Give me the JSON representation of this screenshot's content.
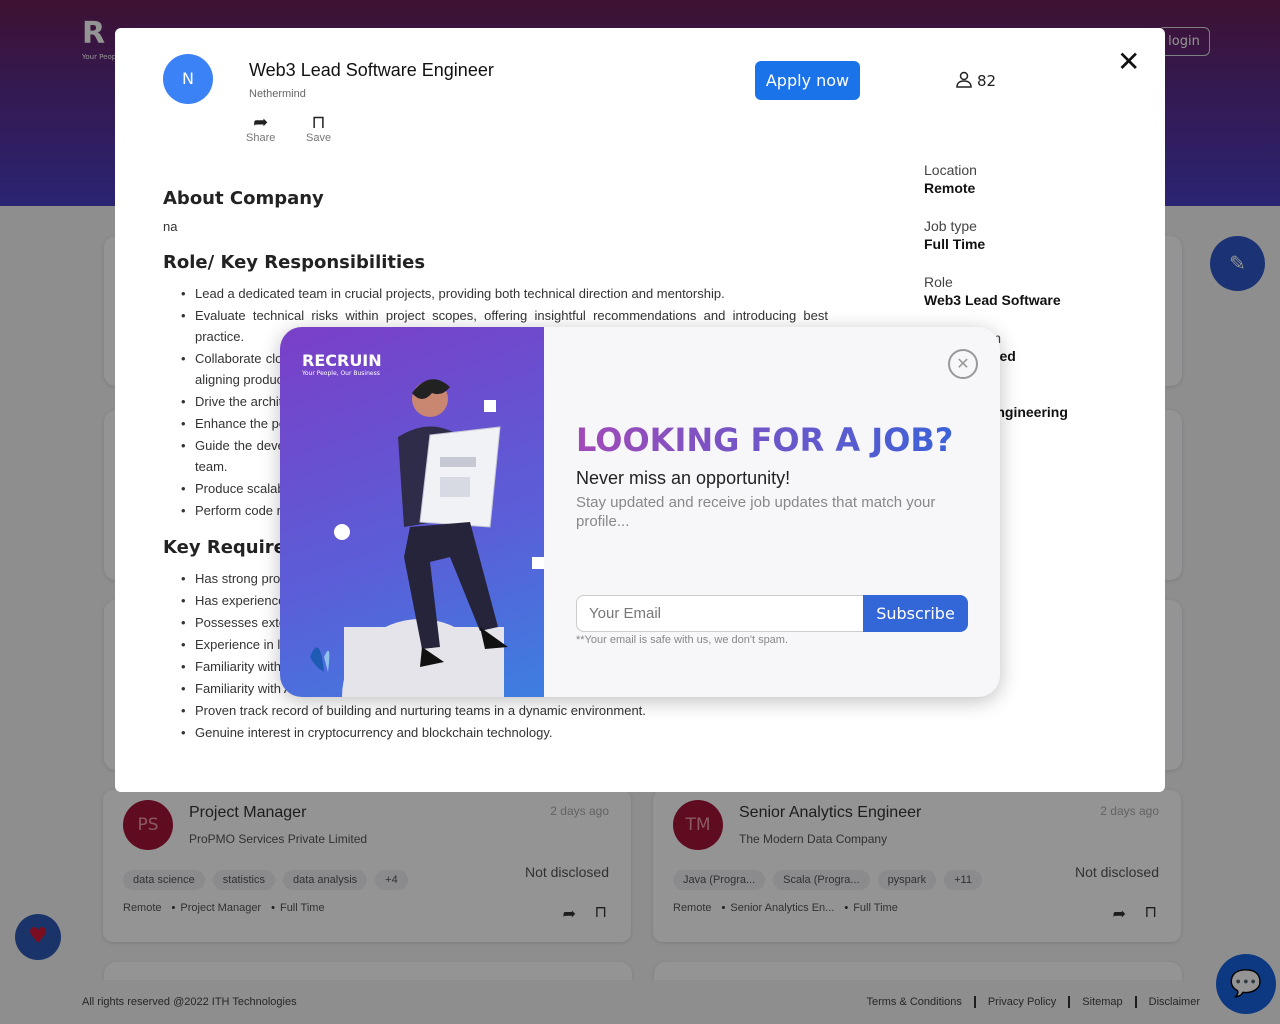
{
  "app": {
    "logo_text": "R",
    "logo_tagline": "Your People, Our Business",
    "login_label": "login",
    "customize_icon": "magic-wand-icon"
  },
  "background_jobs": [
    {
      "avatar": "PS",
      "title": "Project Manager",
      "company": "ProPMO Services Private Limited",
      "posted": "2 days ago",
      "salary": "Not disclosed",
      "tags": [
        "data science",
        "statistics",
        "data analysis",
        "+4"
      ],
      "meta": [
        "Remote",
        "Project Manager",
        "Full Time"
      ]
    },
    {
      "avatar": "TM",
      "title": "Senior Analytics Engineer",
      "company": "The Modern Data Company",
      "posted": "2 days ago",
      "salary": "Not disclosed",
      "tags": [
        "Java (Progra...",
        "Scala (Progra...",
        "pyspark",
        "+11"
      ],
      "meta": [
        "Remote",
        "Senior Analytics En...",
        "Full Time"
      ]
    }
  ],
  "footer": {
    "copyright": "All rights reserved @2022 ITH Technologies",
    "links": [
      "Terms & Conditions",
      "Privacy Policy",
      "Sitemap",
      "Disclaimer"
    ]
  },
  "job_modal": {
    "avatar_letter": "N",
    "title": "Web3 Lead Software Engineer",
    "company": "Nethermind",
    "share_label": "Share",
    "save_label": "Save",
    "apply_label": "Apply now",
    "applicants": "82",
    "about_heading": "About Company",
    "about_text": "na",
    "role_heading": "Role/ Key Responsibilities",
    "responsibilities": [
      "Lead a dedicated team in crucial projects, providing both technical direction and mentorship.",
      "Evaluate technical risks within project scopes, offering insightful recommendations and introducing best practice.",
      "Collaborate closely with stakeholders to understand requirements and translate them into technical solutions, aligning product and customer needs.",
      "Drive the architecture and design of robust, scalable data systems.",
      "Enhance the performance, reliability and efficiency of existing pipelines.",
      "Guide the development of high-quality, well-tested code and foster a culture of engineering excellence in the team.",
      "Produce scalable and maintainable solutions.",
      "Perform code reviews and provide constructive feedback."
    ],
    "req_heading": "Key Requirements",
    "requirements": [
      "Has strong programming skills in Python.",
      "Has experience with distributed data processing.",
      "Possesses extensive experience in data modelling and a deep understanding of databases.",
      "Experience in leading engineering teams.",
      "Familiarity with data engineering practices, tooling and approaches.",
      "Familiarity with Airflow or other similar tools.",
      "Proven track record of building and nurturing teams in a dynamic environment.",
      "Genuine interest in cryptocurrency and blockchain technology."
    ],
    "sidebar": [
      {
        "label": "Location",
        "value": "Remote"
      },
      {
        "label": "Job type",
        "value": "Full Time"
      },
      {
        "label": "Role",
        "value": "Web3 Lead Software"
      },
      {
        "label": "Qualification",
        "value": "Not disclosed"
      },
      {
        "label": "Department",
        "value": "Software Engineering"
      }
    ]
  },
  "subscribe_popup": {
    "logo_text": "RECRUIN",
    "logo_tagline": "Your People, Our Business",
    "headline": "LOOKING FOR A JOB?",
    "subheadline": "Never miss an opportunity!",
    "description": "Stay updated and receive job updates that match your profile...",
    "email_placeholder": "Your Email",
    "subscribe_label": "Subscribe",
    "note": "**Your email is safe with us, we don't spam."
  }
}
